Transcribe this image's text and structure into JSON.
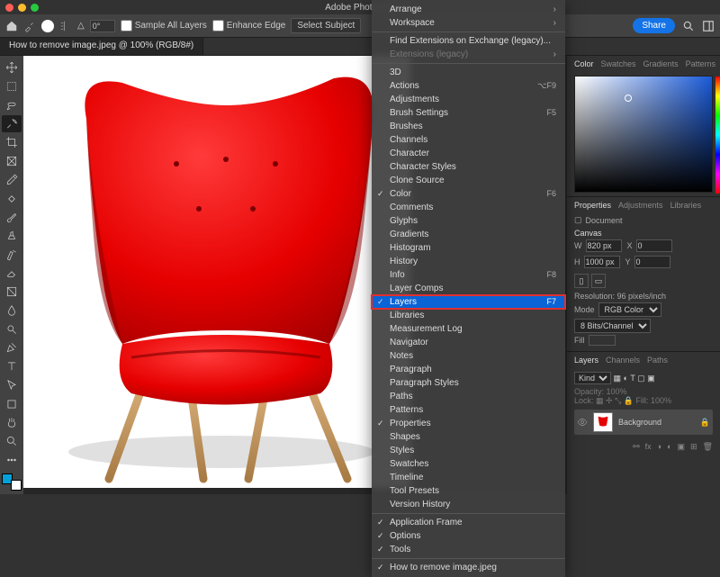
{
  "window": {
    "title": "Adobe Photoshop"
  },
  "optionsbar": {
    "angle": "0°",
    "sample_all": "Sample All Layers",
    "enhance_edge": "Enhance Edge",
    "select_subject": "Select Subject"
  },
  "share": "Share",
  "tab": {
    "label": "How to remove image.jpeg @ 100% (RGB/8#)"
  },
  "right": {
    "color_tabs": [
      "Color",
      "Swatches",
      "Gradients",
      "Patterns"
    ],
    "prop_tabs": [
      "Properties",
      "Adjustments",
      "Libraries"
    ],
    "doc_label": "Document",
    "canvas_label": "Canvas",
    "w_label": "W",
    "w_val": "820 px",
    "x_label": "X",
    "x_val": "0",
    "h_label": "H",
    "h_val": "1000 px",
    "y_label": "Y",
    "y_val": "0",
    "resolution": "Resolution: 96 pixels/inch",
    "mode_label": "Mode",
    "mode_val": "RGB Color",
    "bits_val": "8 Bits/Channel",
    "fill_label": "Fill",
    "layers_tabs": [
      "Layers",
      "Channels",
      "Paths"
    ],
    "layer_kind": "Kind",
    "opacity_label": "Opacity:",
    "opacity_val": "100%",
    "lock_label": "Lock:",
    "fill2_label": "Fill:",
    "fill2_val": "100%",
    "layer_name": "Background"
  },
  "menu": {
    "items": [
      {
        "label": "Arrange",
        "arrow": true
      },
      {
        "label": "Workspace",
        "arrow": true
      },
      {
        "sep": true
      },
      {
        "label": "Find Extensions on Exchange (legacy)..."
      },
      {
        "label": "Extensions (legacy)",
        "disabled": true,
        "arrow": true
      },
      {
        "sep": true
      },
      {
        "label": "3D"
      },
      {
        "label": "Actions",
        "shortcut": "⌥F9"
      },
      {
        "label": "Adjustments"
      },
      {
        "label": "Brush Settings",
        "shortcut": "F5"
      },
      {
        "label": "Brushes"
      },
      {
        "label": "Channels"
      },
      {
        "label": "Character"
      },
      {
        "label": "Character Styles"
      },
      {
        "label": "Clone Source"
      },
      {
        "label": "Color",
        "checked": true,
        "shortcut": "F6"
      },
      {
        "label": "Comments"
      },
      {
        "label": "Glyphs"
      },
      {
        "label": "Gradients"
      },
      {
        "label": "Histogram"
      },
      {
        "label": "History"
      },
      {
        "label": "Info",
        "shortcut": "F8"
      },
      {
        "label": "Layer Comps"
      },
      {
        "label": "Layers",
        "checked": true,
        "selected": true,
        "highlight": true,
        "shortcut": "F7"
      },
      {
        "label": "Libraries"
      },
      {
        "label": "Measurement Log"
      },
      {
        "label": "Navigator"
      },
      {
        "label": "Notes"
      },
      {
        "label": "Paragraph"
      },
      {
        "label": "Paragraph Styles"
      },
      {
        "label": "Paths"
      },
      {
        "label": "Patterns"
      },
      {
        "label": "Properties",
        "checked": true
      },
      {
        "label": "Shapes"
      },
      {
        "label": "Styles"
      },
      {
        "label": "Swatches"
      },
      {
        "label": "Timeline"
      },
      {
        "label": "Tool Presets"
      },
      {
        "label": "Version History"
      },
      {
        "sep": true
      },
      {
        "label": "Application Frame",
        "checked": true
      },
      {
        "label": "Options",
        "checked": true
      },
      {
        "label": "Tools",
        "checked": true
      },
      {
        "sep": true
      },
      {
        "label": "How to remove image.jpeg",
        "checked": true
      }
    ]
  }
}
